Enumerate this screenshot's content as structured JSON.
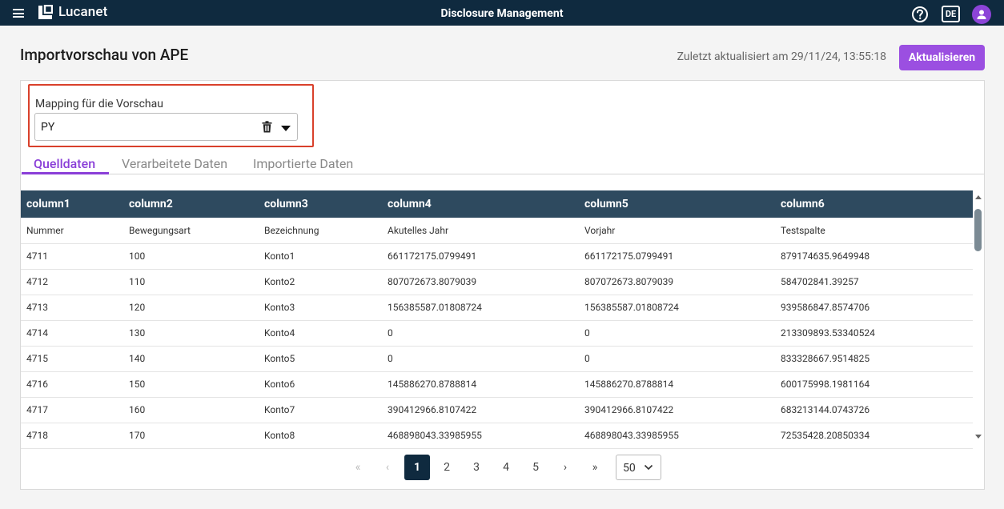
{
  "app": {
    "logo_text": "Lucanet",
    "title": "Disclosure Management",
    "language": "DE"
  },
  "header": {
    "page_title": "Importvorschau von APE",
    "last_updated": "Zuletzt aktualisiert am 29/11/24, 13:55:18",
    "refresh_label": "Aktualisieren"
  },
  "mapping": {
    "label": "Mapping für die Vorschau",
    "value": "PY"
  },
  "tabs": [
    {
      "label": "Quelldaten",
      "active": true
    },
    {
      "label": "Verarbeitete Daten",
      "active": false
    },
    {
      "label": "Importierte Daten",
      "active": false
    }
  ],
  "table": {
    "columns": [
      "column1",
      "column2",
      "column3",
      "column4",
      "column5",
      "column6"
    ],
    "rows": [
      [
        "Nummer",
        "Bewegungsart",
        "Bezeichnung",
        "Akutelles Jahr",
        "Vorjahr",
        "Testspalte"
      ],
      [
        "4711",
        "100",
        "Konto1",
        "661172175.0799491",
        "661172175.0799491",
        "879174635.9649948"
      ],
      [
        "4712",
        "110",
        "Konto2",
        "807072673.8079039",
        "807072673.8079039",
        "584702841.39257"
      ],
      [
        "4713",
        "120",
        "Konto3",
        "156385587.01808724",
        "156385587.01808724",
        "939586847.8574706"
      ],
      [
        "4714",
        "130",
        "Konto4",
        "0",
        "0",
        "213309893.53340524"
      ],
      [
        "4715",
        "140",
        "Konto5",
        "0",
        "0",
        "833328667.9514825"
      ],
      [
        "4716",
        "150",
        "Konto6",
        "145886270.8788814",
        "145886270.8788814",
        "600175998.1981164"
      ],
      [
        "4717",
        "160",
        "Konto7",
        "390412966.8107422",
        "390412966.8107422",
        "683213144.0743726"
      ],
      [
        "4718",
        "170",
        "Konto8",
        "468898043.33985955",
        "468898043.33985955",
        "72535428.20850334"
      ]
    ]
  },
  "pagination": {
    "first": "«",
    "prev": "‹",
    "pages": [
      "1",
      "2",
      "3",
      "4",
      "5"
    ],
    "current": "1",
    "next": "›",
    "last": "»",
    "page_size": "50"
  },
  "colors": {
    "topbar": "#0f2a3f",
    "accent": "#9b4fe1",
    "table_header": "#2e4a5f",
    "highlight_border": "#d9402b"
  }
}
